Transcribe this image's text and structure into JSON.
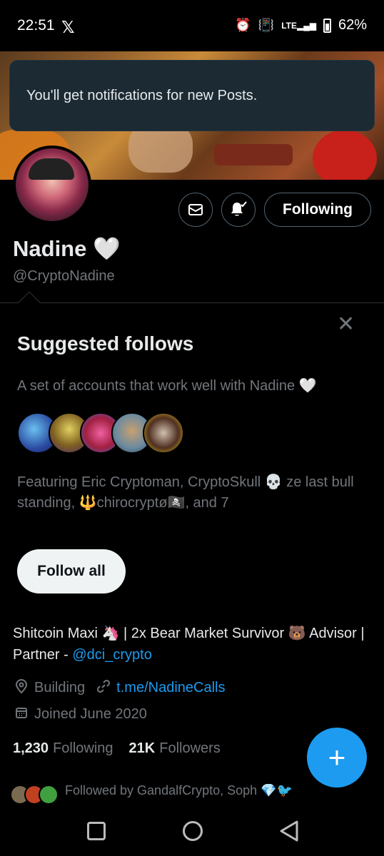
{
  "status_bar": {
    "time": "22:51",
    "app_logo": "𝕏",
    "icons": [
      "alarm-icon",
      "vibrate-icon",
      "lte-signal-icon",
      "battery-icon"
    ],
    "alarm_glyph": "⏰",
    "vibrate_glyph": "📳",
    "signal_text": "LTE",
    "battery": "62%"
  },
  "toast": {
    "message": "You'll get notifications for new Posts."
  },
  "profile": {
    "name": "Nadine 🤍",
    "handle": "@CryptoNadine",
    "following_button": "Following"
  },
  "suggested": {
    "close_label": "✕",
    "title": "Suggested follows",
    "subtitle": "A set of accounts that work well with Nadine 🤍",
    "featuring": "Featuring Eric Cryptoman, CryptoSkull 💀 ze last bull standing, 🔱chirocryptø🏴‍☠️, and 7",
    "follow_all": "Follow all"
  },
  "bio": {
    "text": "Shitcoin Maxi 🦄 | 2x Bear Market Survivor 🐻 Advisor | Partner - ",
    "mention": "@dci_crypto"
  },
  "meta": {
    "location": "Building",
    "link": "t.me/NadineCalls",
    "joined": "Joined June 2020"
  },
  "counts": {
    "following_num": "1,230",
    "following_label": "Following",
    "followers_num": "21K",
    "followers_label": "Followers"
  },
  "followed_by": {
    "text": "Followed by GandalfCrypto, Soph 💎🐦"
  },
  "fab": {
    "label": "+"
  },
  "colors": {
    "accent": "#1d9bf0",
    "background": "#000000",
    "toast_bg": "#1b2a33",
    "muted_text": "#71767b"
  }
}
